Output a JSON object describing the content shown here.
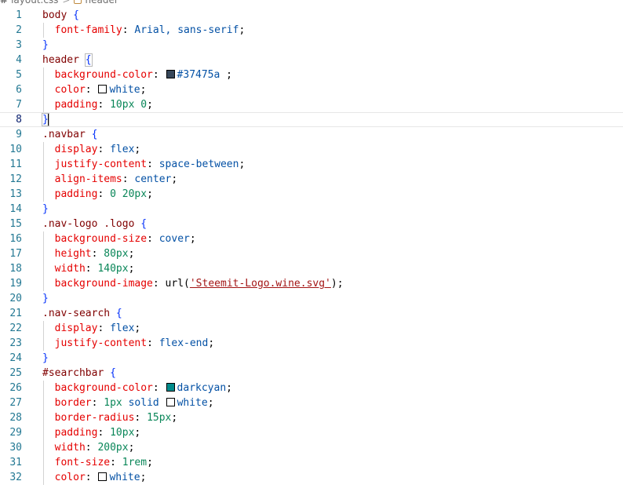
{
  "breadcrumb": {
    "file_icon": "css-hash-icon",
    "file": "layout.css",
    "separator": ">",
    "symbol_icon": "css-selector-icon",
    "symbol": "header"
  },
  "colors": {
    "header_swatch": "#37475a",
    "white_swatch": "#ffffff",
    "darkcyan_swatch": "#008b8b"
  },
  "lines": [
    {
      "n": "1",
      "tokens": [
        {
          "t": "body",
          "c": "sel"
        },
        {
          "t": " "
        },
        {
          "t": "{",
          "c": "brace"
        }
      ]
    },
    {
      "n": "2",
      "guide": true,
      "tokens": [
        {
          "t": "  "
        },
        {
          "t": "font-family",
          "c": "prop"
        },
        {
          "t": ": "
        },
        {
          "t": "Arial, sans-serif",
          "c": "val"
        },
        {
          "t": ";"
        }
      ]
    },
    {
      "n": "3",
      "tokens": [
        {
          "t": "}",
          "c": "brace"
        }
      ]
    },
    {
      "n": "4",
      "tokens": [
        {
          "t": "header",
          "c": "sel"
        },
        {
          "t": " "
        },
        {
          "t": "{",
          "c": "brace",
          "box": true
        }
      ]
    },
    {
      "n": "5",
      "guide": true,
      "tokens": [
        {
          "t": "  "
        },
        {
          "t": "background-color",
          "c": "prop"
        },
        {
          "t": ": "
        },
        {
          "swatch": "#37475a"
        },
        {
          "t": "#37475a",
          "c": "val"
        },
        {
          "t": " ;"
        }
      ]
    },
    {
      "n": "6",
      "guide": true,
      "tokens": [
        {
          "t": "  "
        },
        {
          "t": "color",
          "c": "prop"
        },
        {
          "t": ": "
        },
        {
          "swatch": "#ffffff"
        },
        {
          "t": "white",
          "c": "val"
        },
        {
          "t": ";"
        }
      ]
    },
    {
      "n": "7",
      "guide": true,
      "tokens": [
        {
          "t": "  "
        },
        {
          "t": "padding",
          "c": "prop"
        },
        {
          "t": ": "
        },
        {
          "t": "10px 0",
          "c": "num"
        },
        {
          "t": ";"
        }
      ]
    },
    {
      "n": "8",
      "active": true,
      "tokens": [
        {
          "t": "}",
          "c": "brace",
          "box": true
        },
        {
          "cursor": true
        }
      ]
    },
    {
      "n": "9",
      "tokens": [
        {
          "t": ".navbar",
          "c": "sel"
        },
        {
          "t": " "
        },
        {
          "t": "{",
          "c": "brace"
        }
      ]
    },
    {
      "n": "10",
      "guide": true,
      "tokens": [
        {
          "t": "  "
        },
        {
          "t": "display",
          "c": "prop"
        },
        {
          "t": ": "
        },
        {
          "t": "flex",
          "c": "val"
        },
        {
          "t": ";"
        }
      ]
    },
    {
      "n": "11",
      "guide": true,
      "tokens": [
        {
          "t": "  "
        },
        {
          "t": "justify-content",
          "c": "prop"
        },
        {
          "t": ": "
        },
        {
          "t": "space-between",
          "c": "val"
        },
        {
          "t": ";"
        }
      ]
    },
    {
      "n": "12",
      "guide": true,
      "tokens": [
        {
          "t": "  "
        },
        {
          "t": "align-items",
          "c": "prop"
        },
        {
          "t": ": "
        },
        {
          "t": "center",
          "c": "val"
        },
        {
          "t": ";"
        }
      ]
    },
    {
      "n": "13",
      "guide": true,
      "tokens": [
        {
          "t": "  "
        },
        {
          "t": "padding",
          "c": "prop"
        },
        {
          "t": ": "
        },
        {
          "t": "0 20px",
          "c": "num"
        },
        {
          "t": ";"
        }
      ]
    },
    {
      "n": "14",
      "tokens": [
        {
          "t": "}",
          "c": "brace"
        }
      ]
    },
    {
      "n": "15",
      "tokens": [
        {
          "t": ".nav-logo .logo",
          "c": "sel"
        },
        {
          "t": " "
        },
        {
          "t": "{",
          "c": "brace"
        }
      ]
    },
    {
      "n": "16",
      "guide": true,
      "tokens": [
        {
          "t": "  "
        },
        {
          "t": "background-size",
          "c": "prop"
        },
        {
          "t": ": "
        },
        {
          "t": "cover",
          "c": "val"
        },
        {
          "t": ";"
        }
      ]
    },
    {
      "n": "17",
      "guide": true,
      "tokens": [
        {
          "t": "  "
        },
        {
          "t": "height",
          "c": "prop"
        },
        {
          "t": ": "
        },
        {
          "t": "80px",
          "c": "num"
        },
        {
          "t": ";"
        }
      ]
    },
    {
      "n": "18",
      "guide": true,
      "tokens": [
        {
          "t": "  "
        },
        {
          "t": "width",
          "c": "prop"
        },
        {
          "t": ": "
        },
        {
          "t": "140px",
          "c": "num"
        },
        {
          "t": ";"
        }
      ]
    },
    {
      "n": "19",
      "guide": true,
      "tokens": [
        {
          "t": "  "
        },
        {
          "t": "background-image",
          "c": "prop"
        },
        {
          "t": ": "
        },
        {
          "t": "url("
        },
        {
          "t": "'Steemit-Logo.wine.svg'",
          "c": "str"
        },
        {
          "t": ");"
        }
      ]
    },
    {
      "n": "20",
      "tokens": [
        {
          "t": "}",
          "c": "brace"
        }
      ]
    },
    {
      "n": "21",
      "tokens": [
        {
          "t": ".nav-search",
          "c": "sel"
        },
        {
          "t": " "
        },
        {
          "t": "{",
          "c": "brace"
        }
      ]
    },
    {
      "n": "22",
      "guide": true,
      "tokens": [
        {
          "t": "  "
        },
        {
          "t": "display",
          "c": "prop"
        },
        {
          "t": ": "
        },
        {
          "t": "flex",
          "c": "val"
        },
        {
          "t": ";"
        }
      ]
    },
    {
      "n": "23",
      "guide": true,
      "tokens": [
        {
          "t": "  "
        },
        {
          "t": "justify-content",
          "c": "prop"
        },
        {
          "t": ": "
        },
        {
          "t": "flex-end",
          "c": "val"
        },
        {
          "t": ";"
        }
      ]
    },
    {
      "n": "24",
      "tokens": [
        {
          "t": "}",
          "c": "brace"
        }
      ]
    },
    {
      "n": "25",
      "tokens": [
        {
          "t": "#searchbar",
          "c": "sel"
        },
        {
          "t": " "
        },
        {
          "t": "{",
          "c": "brace"
        }
      ]
    },
    {
      "n": "26",
      "guide": true,
      "tokens": [
        {
          "t": "  "
        },
        {
          "t": "background-color",
          "c": "prop"
        },
        {
          "t": ": "
        },
        {
          "swatch": "#008b8b"
        },
        {
          "t": "darkcyan",
          "c": "val"
        },
        {
          "t": ";"
        }
      ]
    },
    {
      "n": "27",
      "guide": true,
      "tokens": [
        {
          "t": "  "
        },
        {
          "t": "border",
          "c": "prop"
        },
        {
          "t": ": "
        },
        {
          "t": "1px",
          "c": "num"
        },
        {
          "t": " "
        },
        {
          "t": "solid",
          "c": "val"
        },
        {
          "t": " "
        },
        {
          "swatch": "#ffffff"
        },
        {
          "t": "white",
          "c": "val"
        },
        {
          "t": ";"
        }
      ]
    },
    {
      "n": "28",
      "guide": true,
      "tokens": [
        {
          "t": "  "
        },
        {
          "t": "border-radius",
          "c": "prop"
        },
        {
          "t": ": "
        },
        {
          "t": "15px",
          "c": "num"
        },
        {
          "t": ";"
        }
      ]
    },
    {
      "n": "29",
      "guide": true,
      "tokens": [
        {
          "t": "  "
        },
        {
          "t": "padding",
          "c": "prop"
        },
        {
          "t": ": "
        },
        {
          "t": "10px",
          "c": "num"
        },
        {
          "t": ";"
        }
      ]
    },
    {
      "n": "30",
      "guide": true,
      "tokens": [
        {
          "t": "  "
        },
        {
          "t": "width",
          "c": "prop"
        },
        {
          "t": ": "
        },
        {
          "t": "200px",
          "c": "num"
        },
        {
          "t": ";"
        }
      ]
    },
    {
      "n": "31",
      "guide": true,
      "tokens": [
        {
          "t": "  "
        },
        {
          "t": "font-size",
          "c": "prop"
        },
        {
          "t": ": "
        },
        {
          "t": "1rem",
          "c": "num"
        },
        {
          "t": ";"
        }
      ]
    },
    {
      "n": "32",
      "guide": true,
      "tokens": [
        {
          "t": "  "
        },
        {
          "t": "color",
          "c": "prop"
        },
        {
          "t": ": "
        },
        {
          "swatch": "#ffffff"
        },
        {
          "t": "white",
          "c": "val"
        },
        {
          "t": ";"
        }
      ]
    }
  ]
}
